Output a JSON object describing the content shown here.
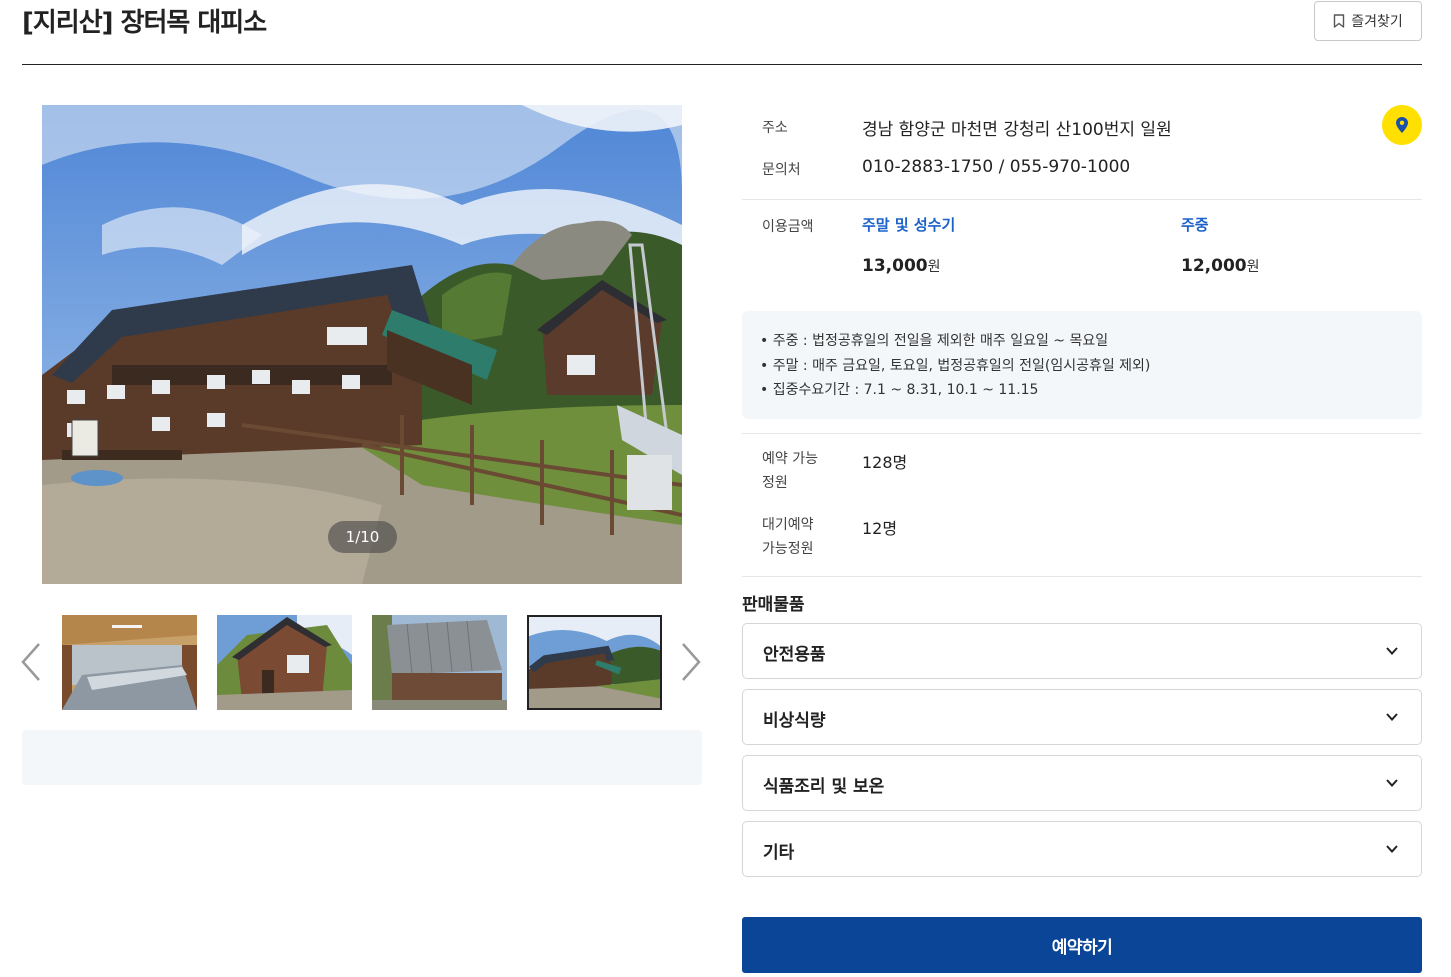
{
  "header": {
    "title": "[지리산] 장터목 대피소",
    "bookmark_label": "즐겨찾기"
  },
  "gallery": {
    "counter": "1/10",
    "thumbnails": [
      {
        "icon": "interior-photo"
      },
      {
        "icon": "shelter-exterior-photo"
      },
      {
        "icon": "metal-shed-photo"
      },
      {
        "icon": "shelter-main-photo"
      }
    ],
    "active_thumbnail_index": 3
  },
  "info": {
    "address_label": "주소",
    "address_value": "경남 함양군 마천면 강청리 산100번지 일원",
    "contact_label": "문의처",
    "contact_value": "010-2883-1750 / 055-970-1000",
    "price_label": "이용금액",
    "price_columns": [
      {
        "label": "주말 및 성수기",
        "amount": "13,000",
        "unit": "원"
      },
      {
        "label": "주중",
        "amount": "12,000",
        "unit": "원"
      }
    ],
    "notices": [
      "• 주중 : 법정공휴일의 전일을 제외한 매주 일요일 ~ 목요일",
      "• 주말 : 매주 금요일, 토요일, 법정공휴일의 전일(임시공휴일 제외)",
      "• 집중수요기간 : 7.1 ~ 8.31, 10.1 ~ 11.15"
    ],
    "capacity_label": "예약 가능\n정원",
    "capacity_value": "128명",
    "waiting_label": "대기예약\n가능정원",
    "waiting_value": "12명"
  },
  "goods": {
    "title": "판매물품",
    "items": [
      "안전용품",
      "비상식량",
      "식품조리 및 보온",
      "기타"
    ]
  },
  "reserve_label": "예약하기",
  "colors": {
    "accent_blue": "#1b61c9",
    "reserve_button": "#0b4597",
    "map_marker_bg": "#ffe000",
    "notice_bg": "#f4f7fa"
  }
}
